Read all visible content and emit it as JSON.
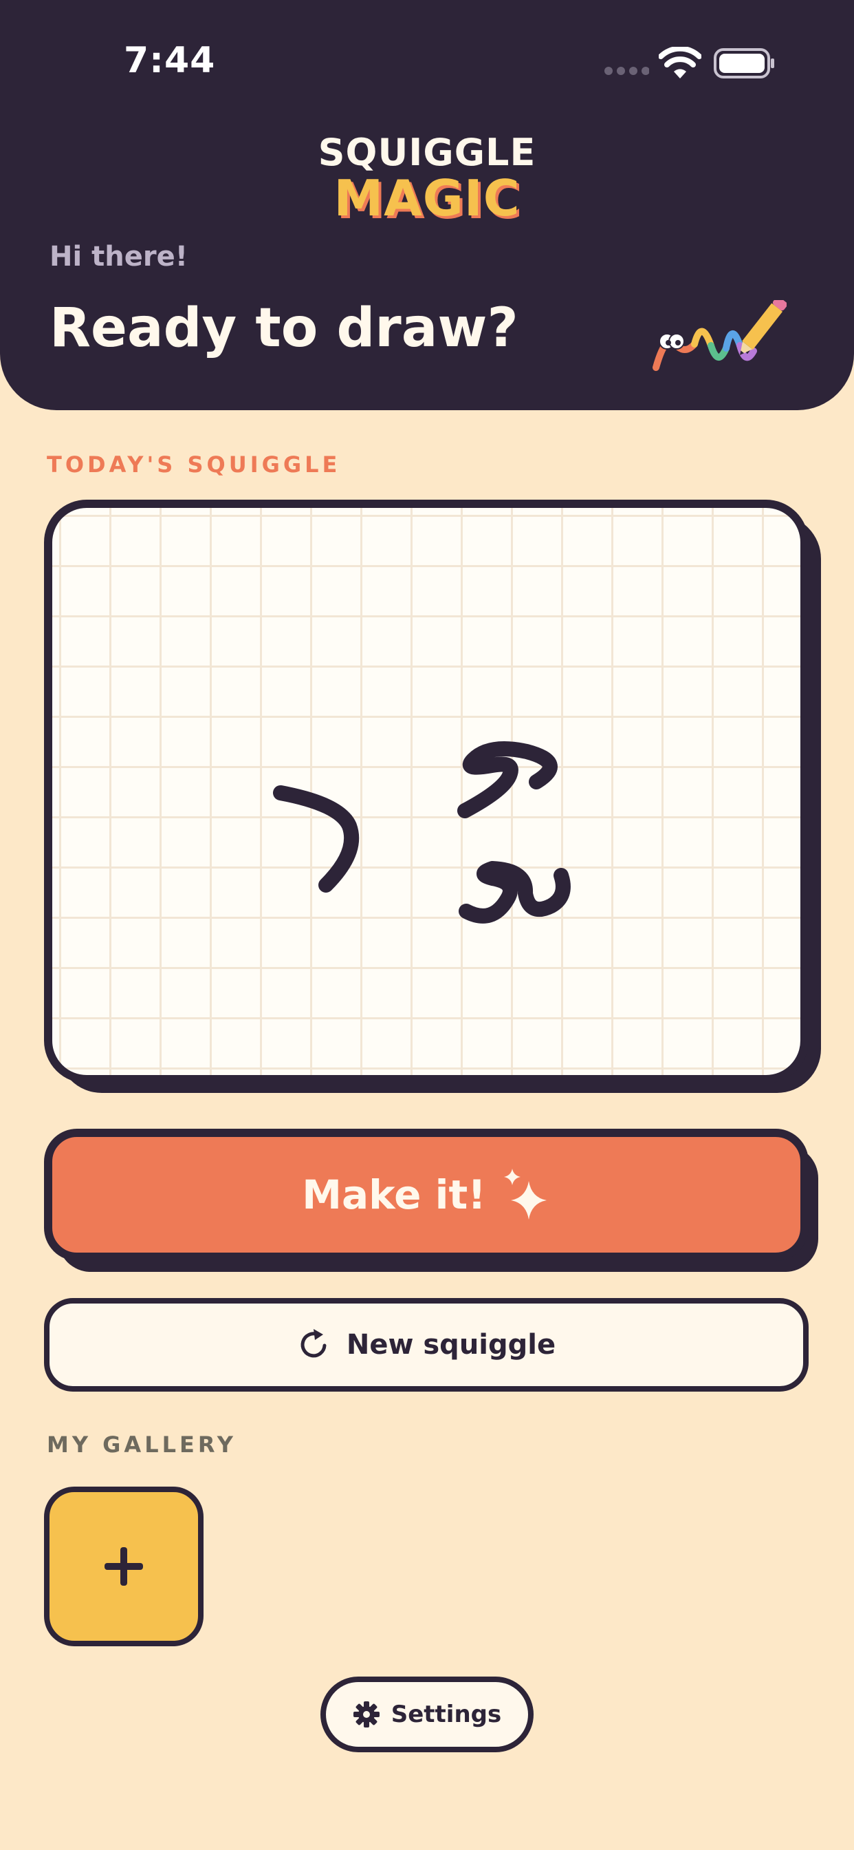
{
  "status_bar": {
    "time": "7:44"
  },
  "logo": {
    "line1": "SQUIGGLE",
    "line2": "MAGIC"
  },
  "header": {
    "greeting": "Hi there!",
    "headline": "Ready to draw?"
  },
  "sections": {
    "today": "TODAY'S SQUIGGLE",
    "gallery": "MY GALLERY"
  },
  "actions": {
    "make": "Make it!",
    "new_squiggle": "New squiggle",
    "settings": "Settings"
  },
  "icons": {
    "status": [
      "signal-dots-icon",
      "wifi-icon",
      "battery-icon"
    ],
    "header_art": "rainbow-worm-pencil-icon",
    "make": "sparkles-icon",
    "new_squiggle": "refresh-icon",
    "gallery_add": "plus-icon",
    "settings": "gear-icon"
  },
  "colors": {
    "header_bg": "#2D2438",
    "page_bg": "#FDE8C8",
    "accent_orange": "#EE7A56",
    "accent_yellow": "#F6C14E",
    "ink": "#2D2438",
    "paper": "#FFFDF7"
  }
}
